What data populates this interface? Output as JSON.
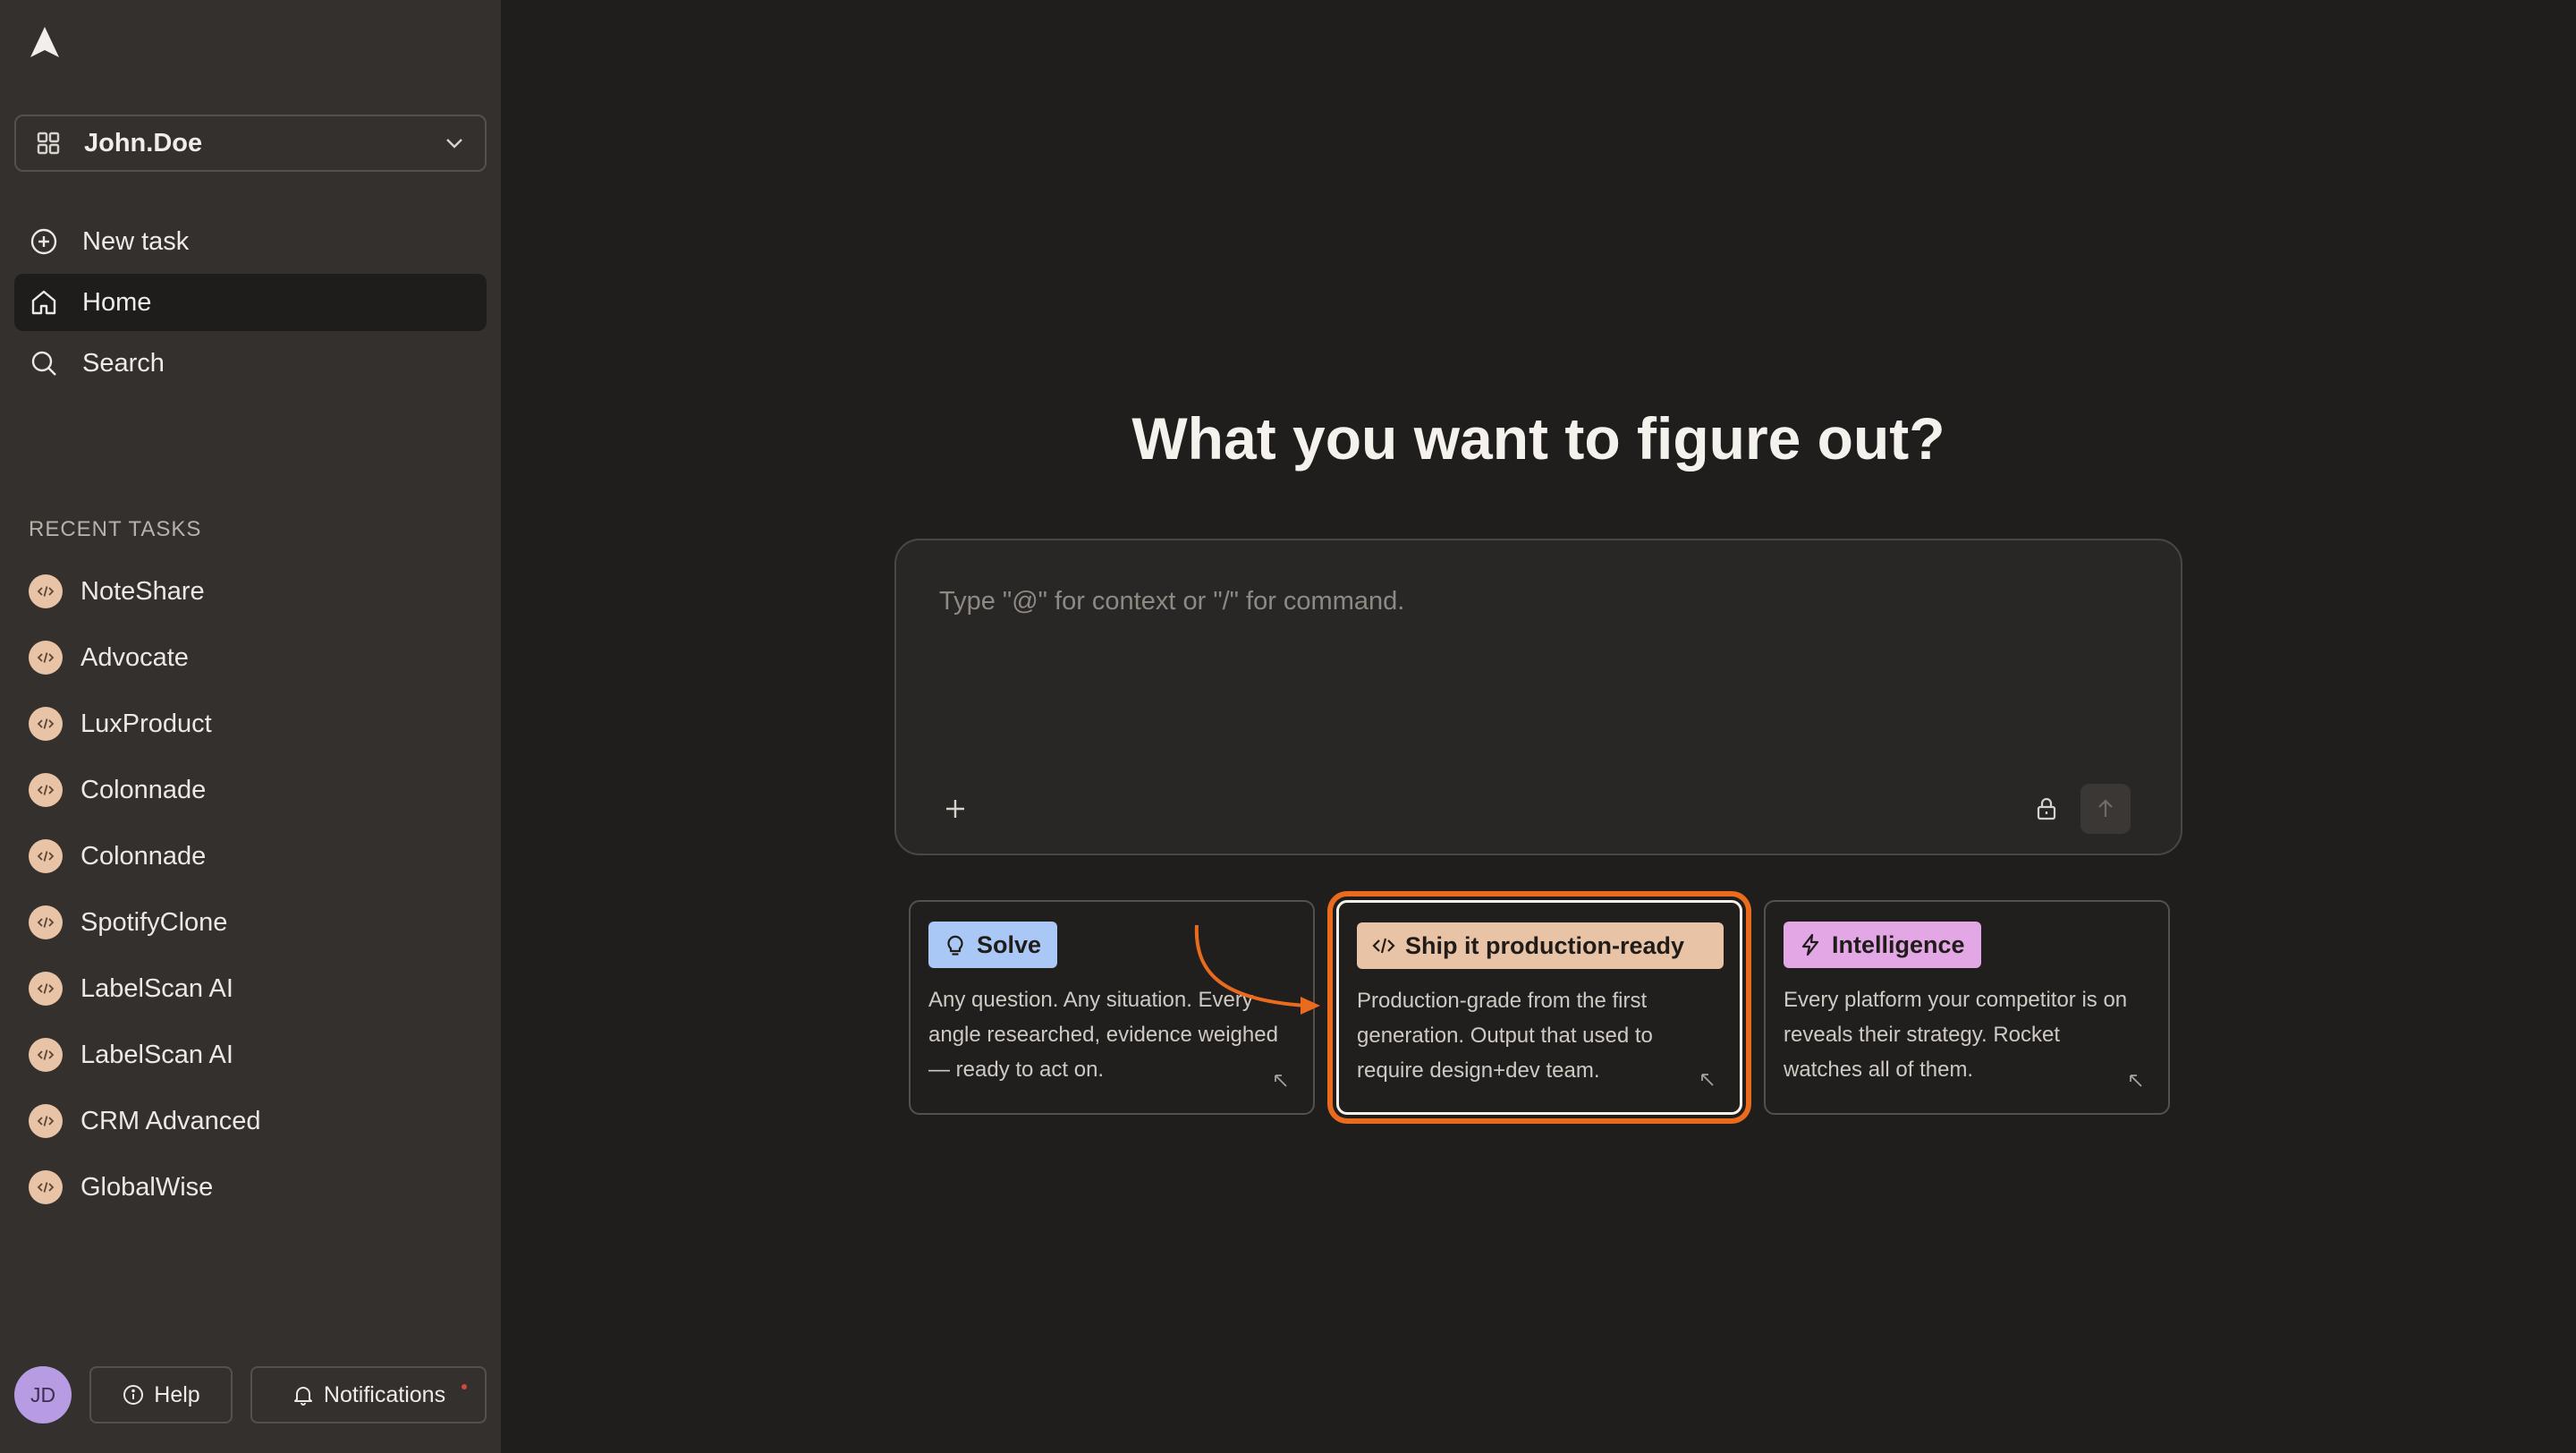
{
  "sidebar": {
    "workspace_name": "John.Doe",
    "nav": [
      {
        "label": "New task",
        "icon": "plus-circle-icon"
      },
      {
        "label": "Home",
        "icon": "home-icon",
        "active": true
      },
      {
        "label": "Search",
        "icon": "search-icon"
      }
    ],
    "recent_title": "RECENT TASKS",
    "recent": [
      "NoteShare",
      "Advocate",
      "LuxProduct",
      "Colonnade",
      "Colonnade",
      "SpotifyClone",
      "LabelScan AI",
      "LabelScan AI",
      "CRM Advanced",
      "GlobalWise"
    ],
    "footer": {
      "avatar_initials": "JD",
      "help_label": "Help",
      "notifications_label": "Notifications"
    }
  },
  "main": {
    "headline": "What you want to figure out?",
    "composer": {
      "placeholder": "Type \"@\" for context or \"/\" for command.",
      "value": ""
    },
    "cards": [
      {
        "title": "Solve",
        "icon": "lightbulb-icon",
        "color": "#a9c8f5",
        "description": "Any question. Any situation. Every angle researched, evidence weighed — ready to act on."
      },
      {
        "title": "Ship it production-ready",
        "icon": "code-icon",
        "color": "#e8c3a6",
        "description": "Production-grade from the first generation. Output that used to require design+dev team.",
        "highlighted": true
      },
      {
        "title": "Intelligence",
        "icon": "lightning-icon",
        "color": "#e3a7e6",
        "description": "Every platform your competitor is on reveals their strategy. Rocket watches all of them."
      }
    ]
  },
  "colors": {
    "highlight": "#ea6b1e",
    "sidebar_bg": "#34302d",
    "main_bg": "#201e1d"
  }
}
